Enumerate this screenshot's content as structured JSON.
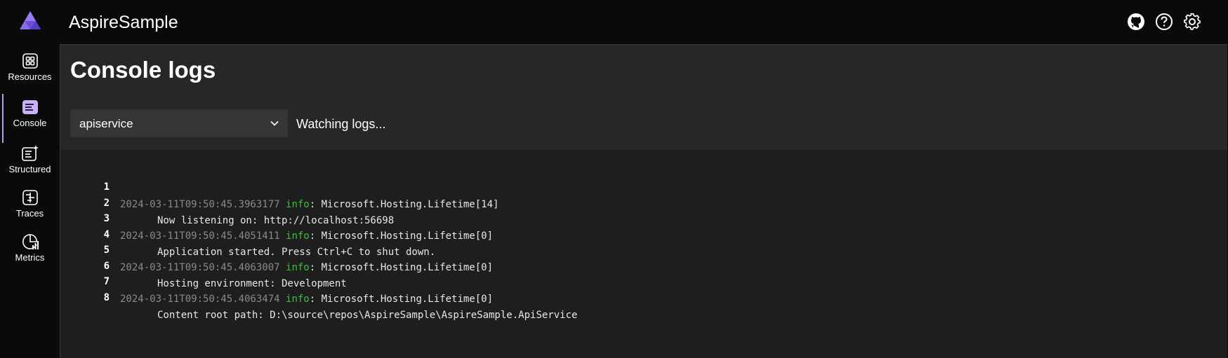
{
  "app": {
    "title": "AspireSample"
  },
  "nav": {
    "items": [
      {
        "label": "Resources",
        "icon": "resources-grid-icon"
      },
      {
        "label": "Console",
        "icon": "console-icon",
        "active": true
      },
      {
        "label": "Structured",
        "icon": "structured-logs-icon"
      },
      {
        "label": "Traces",
        "icon": "traces-icon"
      },
      {
        "label": "Metrics",
        "icon": "metrics-icon"
      }
    ]
  },
  "header": {
    "icons": [
      "github-icon",
      "help-icon",
      "settings-icon"
    ]
  },
  "page": {
    "title": "Console logs",
    "resource_select": {
      "value": "apiservice"
    },
    "status": "Watching logs..."
  },
  "logs": [
    {
      "num": "1",
      "timestamp": "2024-03-11T09:50:45.3963177",
      "level": "info",
      "message": ": Microsoft.Hosting.Lifetime[14]"
    },
    {
      "num": "2",
      "text": "Now listening on: http://localhost:56698"
    },
    {
      "num": "3",
      "timestamp": "2024-03-11T09:50:45.4051411",
      "level": "info",
      "message": ": Microsoft.Hosting.Lifetime[0]"
    },
    {
      "num": "4",
      "text": "Application started. Press Ctrl+C to shut down."
    },
    {
      "num": "5",
      "timestamp": "2024-03-11T09:50:45.4063007",
      "level": "info",
      "message": ": Microsoft.Hosting.Lifetime[0]"
    },
    {
      "num": "6",
      "text": "Hosting environment: Development"
    },
    {
      "num": "7",
      "timestamp": "2024-03-11T09:50:45.4063474",
      "level": "info",
      "message": ": Microsoft.Hosting.Lifetime[0]"
    },
    {
      "num": "8",
      "text": "Content root path: D:\\source\\repos\\AspireSample\\AspireSample.ApiService"
    }
  ],
  "colors": {
    "accent": "#b99cf0",
    "info": "#3ebd3e",
    "timestamp": "#8a8a8a"
  }
}
